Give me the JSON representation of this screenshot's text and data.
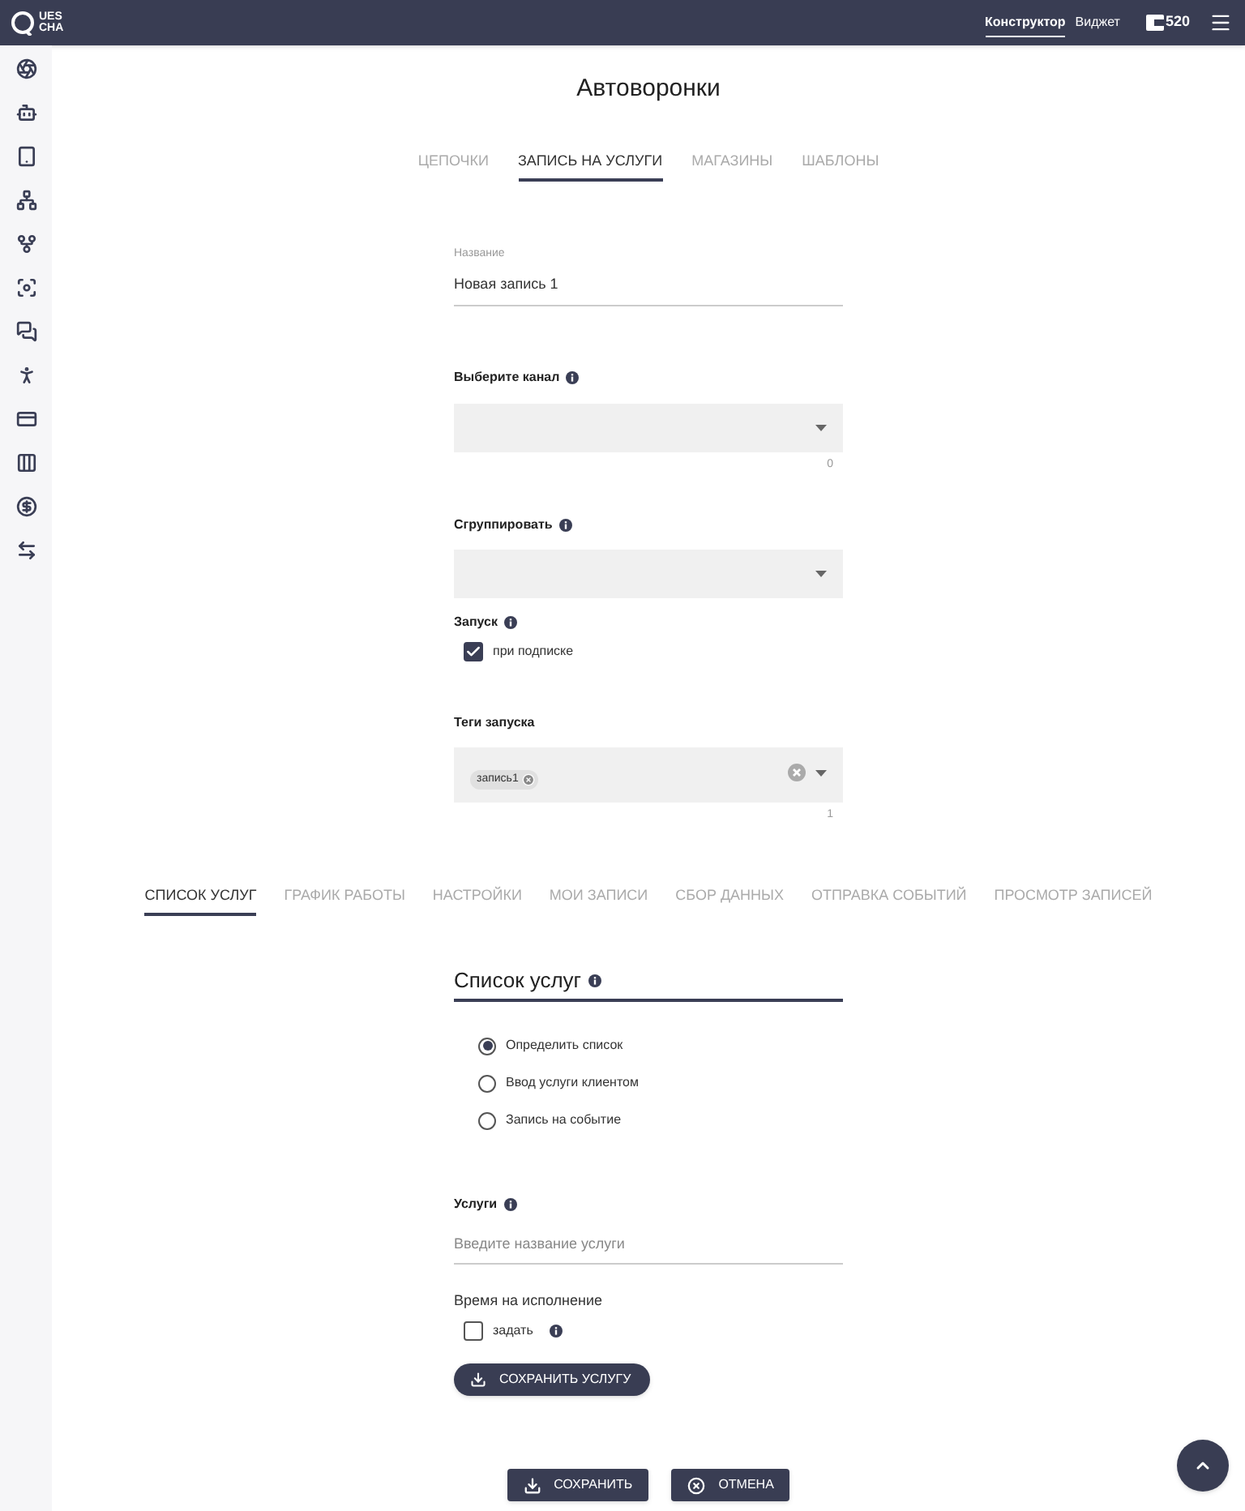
{
  "header": {
    "logo": [
      "UES",
      "CHA"
    ],
    "nav": [
      {
        "label": "Конструктор",
        "selected": true
      },
      {
        "label": "Виджет",
        "selected": false
      }
    ],
    "balance": "520"
  },
  "title": "Автоворонки",
  "tabs": [
    {
      "label": "ЦЕПОЧКИ",
      "selected": false
    },
    {
      "label": "ЗАПИСЬ НА УСЛУГИ",
      "selected": true
    },
    {
      "label": "МАГАЗИНЫ",
      "selected": false
    },
    {
      "label": "ШАБЛОНЫ",
      "selected": false
    }
  ],
  "form": {
    "name": {
      "label": "Название",
      "value": "Новая запись 1"
    },
    "channel": {
      "label": "Выберите канал",
      "counter": "0"
    },
    "group": {
      "label": "Сгруппировать"
    },
    "launch": {
      "label": "Запуск",
      "option": "при подписке",
      "checked": true
    },
    "tags": {
      "label": "Теги запуска",
      "chips": [
        "запись1"
      ],
      "counter": "1"
    }
  },
  "section_tabs": [
    {
      "label": "СПИСОК УСЛУГ",
      "selected": true
    },
    {
      "label": "ГРАФИК РАБОТЫ",
      "selected": false
    },
    {
      "label": "НАСТРОЙКИ",
      "selected": false
    },
    {
      "label": "МОИ ЗАПИСИ",
      "selected": false
    },
    {
      "label": "СБОР ДАННЫХ",
      "selected": false
    },
    {
      "label": "ОТПРАВКА СОБЫТИЙ",
      "selected": false
    },
    {
      "label": "ПРОСМОТР ЗАПИСЕЙ",
      "selected": false
    }
  ],
  "services": {
    "heading": "Список услуг",
    "options": [
      {
        "label": "Определить список",
        "selected": true
      },
      {
        "label": "Ввод услуги клиентом",
        "selected": false
      },
      {
        "label": "Запись на событие",
        "selected": false
      }
    ],
    "field": {
      "label": "Услуги",
      "placeholder": "Введите название услуги"
    },
    "time": {
      "label": "Время на исполнение",
      "option": "задать",
      "checked": false
    },
    "save_service": "СОХРАНИТЬ УСЛУГУ"
  },
  "buttons": [
    {
      "kind": "save",
      "label": "СОХРАНИТЬ"
    },
    {
      "kind": "cancel",
      "label": "ОТМЕНА"
    }
  ]
}
